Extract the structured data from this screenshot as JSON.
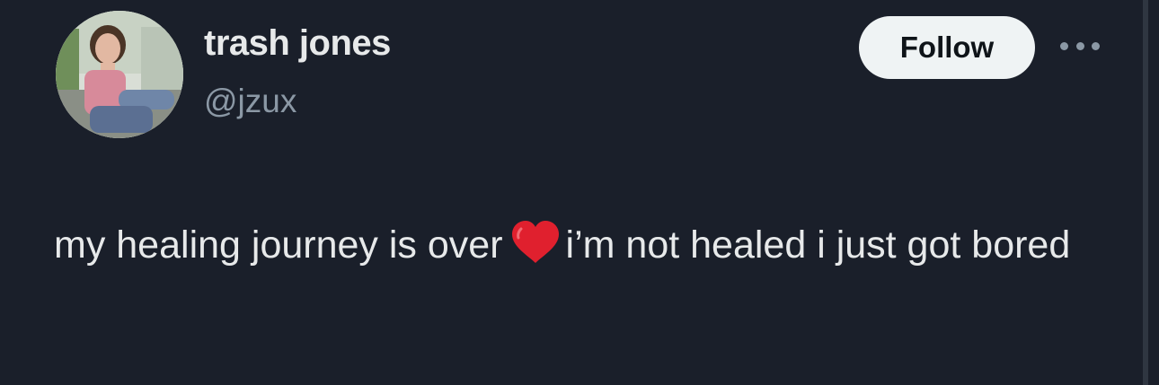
{
  "author": {
    "display_name": "trash jones",
    "handle": "@jzux"
  },
  "actions": {
    "follow_label": "Follow",
    "more_icon": "more-horizontal-icon"
  },
  "tweet": {
    "text_before_emoji": "my healing journey is over",
    "emoji": "heart-emoji",
    "text_after_emoji": "i’m not healed i just got bored"
  },
  "colors": {
    "background": "#1a1f2a",
    "primary_text": "#e7e9ea",
    "secondary_text": "#8b98a5",
    "follow_button_bg": "#eff3f4",
    "heart": "#e0202e"
  }
}
